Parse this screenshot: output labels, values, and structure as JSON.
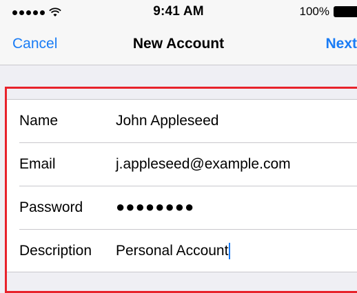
{
  "status_bar": {
    "time": "9:41 AM",
    "battery_percent": "100%",
    "signal_dots": 5,
    "icons": [
      "signal-dots-icon",
      "wifi-icon",
      "battery-icon"
    ]
  },
  "nav": {
    "cancel_label": "Cancel",
    "title": "New Account",
    "next_label": "Next"
  },
  "form": {
    "rows": [
      {
        "label": "Name",
        "value": "John Appleseed"
      },
      {
        "label": "Email",
        "value": "j.appleseed@example.com"
      },
      {
        "label": "Password",
        "value": "●●●●●●●●"
      },
      {
        "label": "Description",
        "value": "Personal Account"
      }
    ]
  },
  "colors": {
    "accent": "#1a7cf5",
    "highlight_border": "#e8222b",
    "background": "#efeff4"
  }
}
